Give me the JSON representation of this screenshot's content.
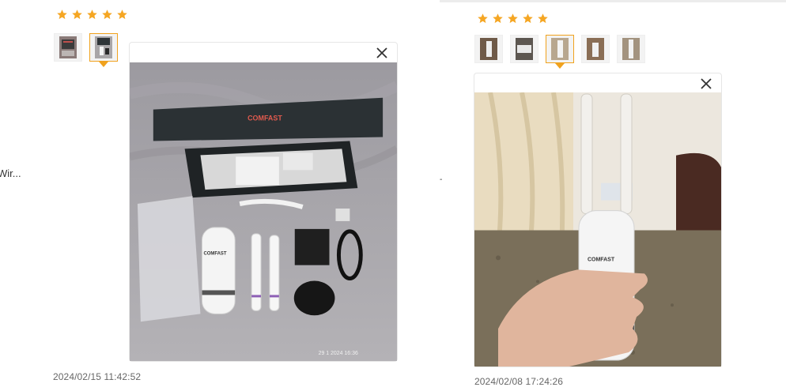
{
  "review_left": {
    "rating_stars": 5,
    "thumbnails": [
      {
        "icon": "product-photo-thumbnail"
      },
      {
        "icon": "product-photo-thumbnail",
        "active": true
      }
    ],
    "viewer": {
      "close_icon": "close-icon",
      "photo": "unboxed-wifi-router-photo"
    },
    "brand_on_box": "COMFAST",
    "photo_timestamp": "29 1 2024 16:36",
    "date": "2024/02/15 11:42:52"
  },
  "review_right": {
    "rating_stars": 5,
    "thumbnails": [
      {
        "icon": "product-photo-thumbnail"
      },
      {
        "icon": "product-photo-thumbnail"
      },
      {
        "icon": "product-photo-thumbnail",
        "active": true
      },
      {
        "icon": "product-photo-thumbnail"
      },
      {
        "icon": "product-photo-thumbnail"
      }
    ],
    "viewer": {
      "close_icon": "close-icon",
      "photo": "hand-holding-router-photo"
    },
    "brand_on_device": "COMFAST",
    "date": "2024/02/08 17:24:26"
  },
  "left_clipped_text": "Wir...",
  "middle_clipped_text": "-",
  "colors": {
    "star": "#f5a623",
    "accent": "#f0a21e",
    "date": "#666666"
  }
}
